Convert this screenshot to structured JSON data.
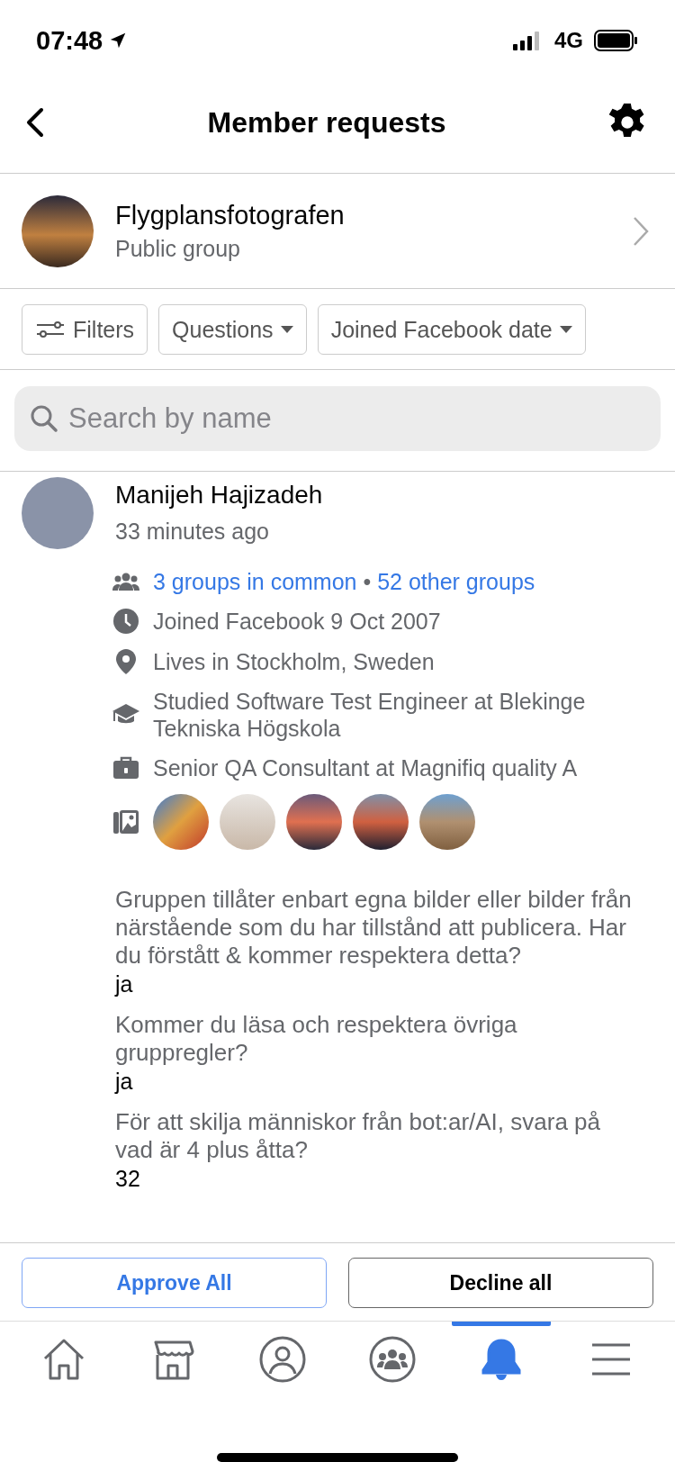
{
  "status_bar": {
    "time": "07:48",
    "network": "4G"
  },
  "header": {
    "title": "Member requests"
  },
  "group": {
    "name": "Flygplansfotografen",
    "subtitle": "Public group"
  },
  "filters": [
    {
      "label": "Filters",
      "kind": "filter"
    },
    {
      "label": "Questions",
      "kind": "dropdown"
    },
    {
      "label": "Joined Facebook date",
      "kind": "dropdown"
    }
  ],
  "search": {
    "placeholder": "Search by name"
  },
  "member": {
    "name": "Manijeh Hajizadeh",
    "time": "33 minutes ago",
    "details": [
      {
        "kind": "groups",
        "link_1": "3 groups in common",
        "separator": "•",
        "link_2": "52 other groups"
      },
      {
        "kind": "clock",
        "lines": [
          "Joined Facebook 9 Oct 2007"
        ]
      },
      {
        "kind": "pin",
        "lines": [
          "Lives in Stockholm, Sweden"
        ]
      },
      {
        "kind": "school",
        "lines": [
          "Studied Software Test Engineer at Blekinge",
          "Tekniska Högskola"
        ]
      },
      {
        "kind": "work",
        "lines": [
          "Senior QA Consultant at Magnifiq quality A"
        ]
      },
      {
        "kind": "photos"
      }
    ],
    "questions": [
      {
        "question": "Gruppen tillåter enbart egna bilder eller bilder från närstående som du har tillstånd att publicera. Har du förstått & kommer respektera detta?",
        "answer": "ja"
      },
      {
        "question": "Kommer du läsa och respektera övriga gruppregler?",
        "answer": "ja"
      },
      {
        "question": "För att skilja människor från bot:ar/AI, svara på vad är 4 plus åtta?",
        "answer": "32"
      }
    ]
  },
  "actions": [
    {
      "label": "Approve All",
      "kind": "primary"
    },
    {
      "label": "Decline all",
      "kind": "secondary"
    }
  ],
  "nav": [
    {
      "selected": false
    },
    {
      "selected": false
    },
    {
      "selected": false
    },
    {
      "selected": false
    },
    {
      "selected": true
    },
    {
      "selected": false
    }
  ]
}
